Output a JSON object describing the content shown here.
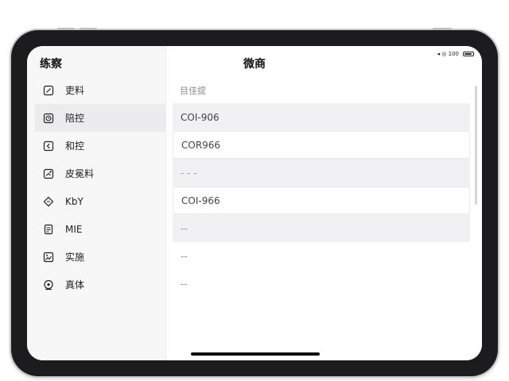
{
  "status_bar": {
    "indicators": "◂ ◎ 100"
  },
  "sidebar": {
    "title": "练察",
    "items": [
      {
        "label": "吏料",
        "icon": "note-edit-icon",
        "active": false
      },
      {
        "label": "陪控",
        "icon": "clock-badge-icon",
        "active": true
      },
      {
        "label": "和控",
        "icon": "back-square-icon",
        "active": false
      },
      {
        "label": "皮冕料",
        "icon": "tag-edit-icon",
        "active": false
      },
      {
        "label": "KbY",
        "icon": "diamond-icon",
        "active": false
      },
      {
        "label": "MIE",
        "icon": "document-icon",
        "active": false
      },
      {
        "label": "实施",
        "icon": "image-frame-icon",
        "active": false
      },
      {
        "label": "真体",
        "icon": "target-icon",
        "active": false
      }
    ]
  },
  "main": {
    "title": "微商",
    "section_header": "目佳提",
    "rows": [
      {
        "value": "COI-906",
        "style": "shaded"
      },
      {
        "value": "COR966",
        "style": "bordered"
      },
      {
        "value": "- - -",
        "style": "shaded dim"
      },
      {
        "value": "COI-966",
        "style": "bordered"
      },
      {
        "value": "--",
        "style": "shaded dim"
      },
      {
        "value": "--",
        "style": "plain"
      },
      {
        "value": "--",
        "style": "plain"
      }
    ]
  }
}
